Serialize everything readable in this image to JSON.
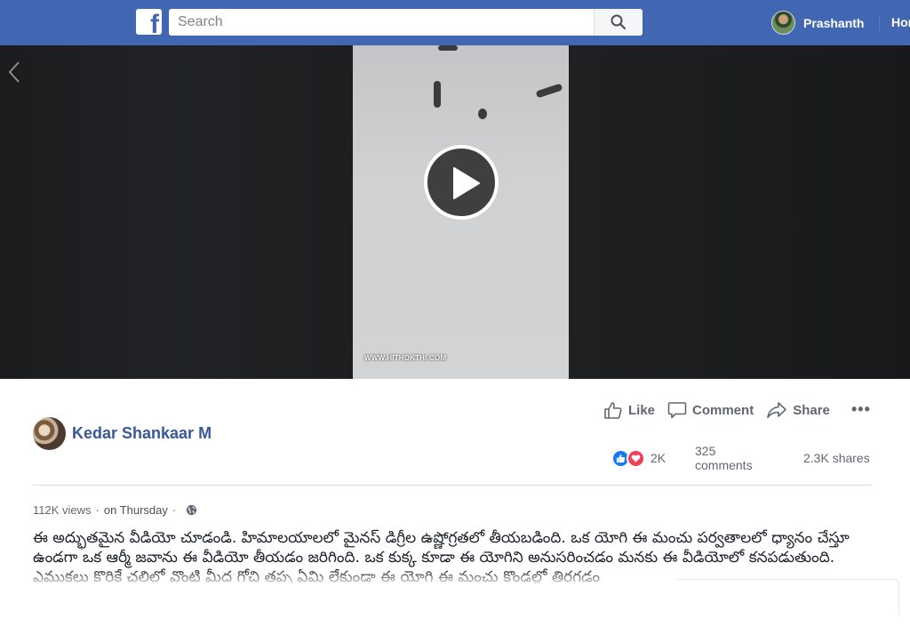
{
  "header": {
    "logo_letter": "f",
    "search_placeholder": "Search",
    "user_name": "Prashanth",
    "home_label": "Home"
  },
  "video": {
    "watermark": "WWW.HITHOKTHI.COM"
  },
  "post": {
    "author": "Kedar Shankaar M",
    "actions": {
      "like": "Like",
      "comment": "Comment",
      "share": "Share",
      "more": "•••"
    },
    "stats": {
      "reactions": "2K",
      "comments": "325 comments",
      "shares": "2.3K shares"
    },
    "views": "112K views",
    "meta_sep": "·",
    "posted": "on Thursday",
    "description": "ఈ అద్భుతమైన వీడియో చూడండి. హిమాలయాలలో మైనస్ డిగ్రీల ఉష్ణోగ్రతలో తీయబడింది. ఒక యోగి ఈ మంచు పర్వతాలలో ధ్యానం చేస్తూ ఉండగా ఒక ఆర్మీ జవాను ఈ వీడియో తీయడం జరిగింది. ఒక కుక్క కూడా ఈ యోగిని అనుసరించడం మనకు ఈ వీడియోలో కనపడుతుంది. ఎముకలు కొరికే చలిలో వొంటి మీద గోచి తప్ప ఏమి లేకుండా ఈ యోగి ఈ మంచు కొండల్లో తిరగడం"
  },
  "colors": {
    "brand": "#4267b2",
    "link": "#385898",
    "like": "#1877f2",
    "love": "#f33e58"
  }
}
